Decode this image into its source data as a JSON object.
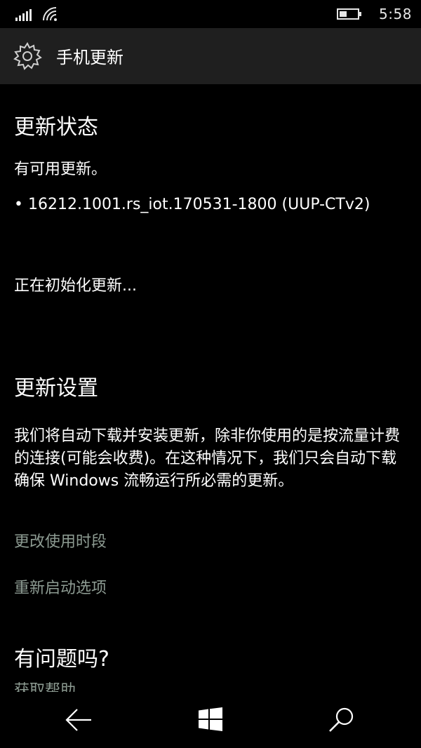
{
  "status_bar": {
    "time": "5:58"
  },
  "header": {
    "title": "手机更新",
    "icon": "gear-icon"
  },
  "update_status": {
    "heading": "更新状态",
    "available_text": "有可用更新。",
    "update_item": "• 16212.1001.rs_iot.170531-1800 (UUP-CTv2)",
    "progress_text": "正在初始化更新..."
  },
  "update_settings": {
    "heading": "更新设置",
    "description": "我们将自动下载并安装更新，除非你使用的是按流量计费的连接(可能会收费)。在这种情况下，我们只会自动下载确保 Windows 流畅运行所必需的更新。",
    "link_active_hours": "更改使用时段",
    "link_restart_options": "重新启动选项"
  },
  "help": {
    "heading": "有问题吗?",
    "link_get_help": "获取帮助"
  },
  "nav": {
    "back": "back-arrow-icon",
    "start": "windows-logo-icon",
    "search": "search-icon"
  },
  "colors": {
    "background": "#000000",
    "header_bg": "#1f1f1f",
    "link": "#8d9b92",
    "text": "#ffffff"
  }
}
